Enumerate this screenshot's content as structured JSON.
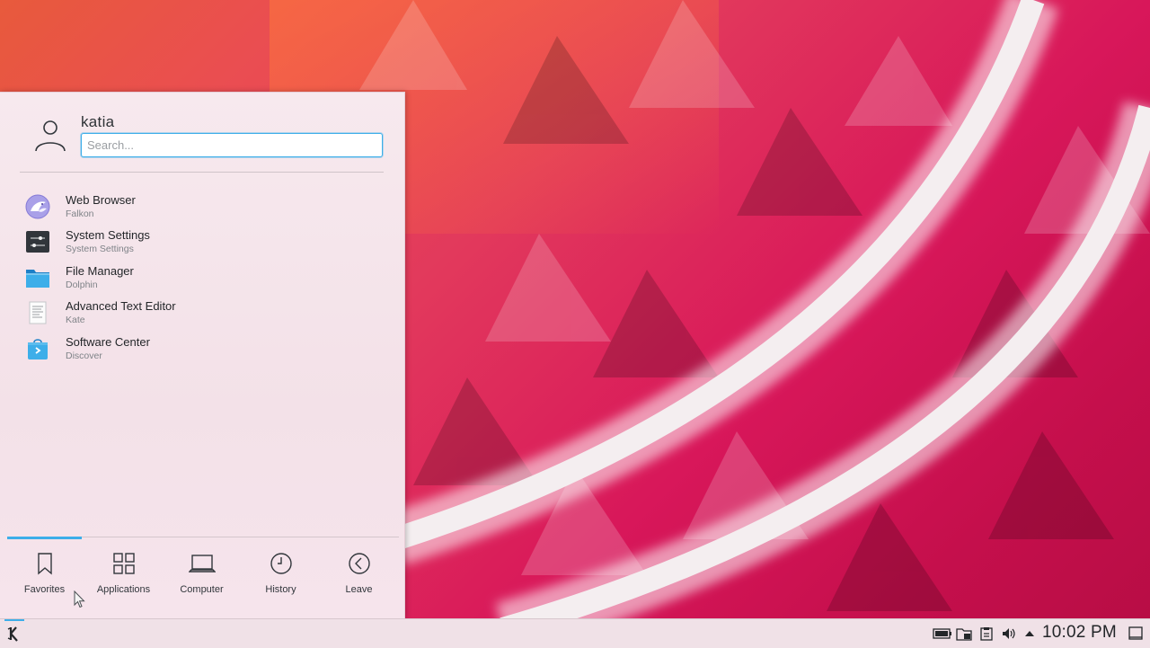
{
  "launcher": {
    "user_name": "katia",
    "search_placeholder": "Search...",
    "favorites": [
      {
        "name": "Web Browser",
        "sub": "Falkon",
        "icon": "falkon-icon"
      },
      {
        "name": "System Settings",
        "sub": "System Settings",
        "icon": "system-settings-icon"
      },
      {
        "name": "File Manager",
        "sub": "Dolphin",
        "icon": "folder-icon"
      },
      {
        "name": "Advanced Text Editor",
        "sub": "Kate",
        "icon": "text-editor-icon"
      },
      {
        "name": "Software Center",
        "sub": "Discover",
        "icon": "software-center-icon"
      }
    ],
    "tabs": [
      {
        "label": "Favorites",
        "icon": "bookmark-icon",
        "active": true
      },
      {
        "label": "Applications",
        "icon": "grid-icon"
      },
      {
        "label": "Computer",
        "icon": "laptop-icon"
      },
      {
        "label": "History",
        "icon": "clock-icon"
      },
      {
        "label": "Leave",
        "icon": "back-circle-icon"
      }
    ]
  },
  "panel": {
    "clock": "10:02 PM",
    "tray_icons": [
      "battery-icon",
      "device-notifier-icon",
      "clipboard-icon",
      "volume-icon",
      "expand-arrow-icon",
      "show-desktop-icon"
    ]
  },
  "colors": {
    "accent": "#3daee9",
    "wallpaper_primary": "#d8175a",
    "wallpaper_secondary": "#e85a3c"
  }
}
